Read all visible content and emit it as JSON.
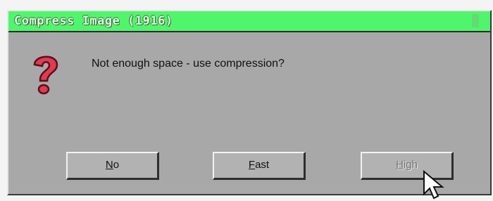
{
  "dialog": {
    "title": "Compress Image (1916)",
    "message": "Not enough space - use compression?",
    "icon": "question-mark-icon",
    "buttons": {
      "no": {
        "hotkey": "N",
        "rest": "o"
      },
      "fast": {
        "hotkey": "F",
        "rest": "ast"
      },
      "high": {
        "hotkey": "H",
        "rest": "igh"
      }
    }
  },
  "colors": {
    "titlebar": "#4ff56a",
    "dialog_bg": "#a8a8a8",
    "icon_red": "#e23a4e"
  }
}
